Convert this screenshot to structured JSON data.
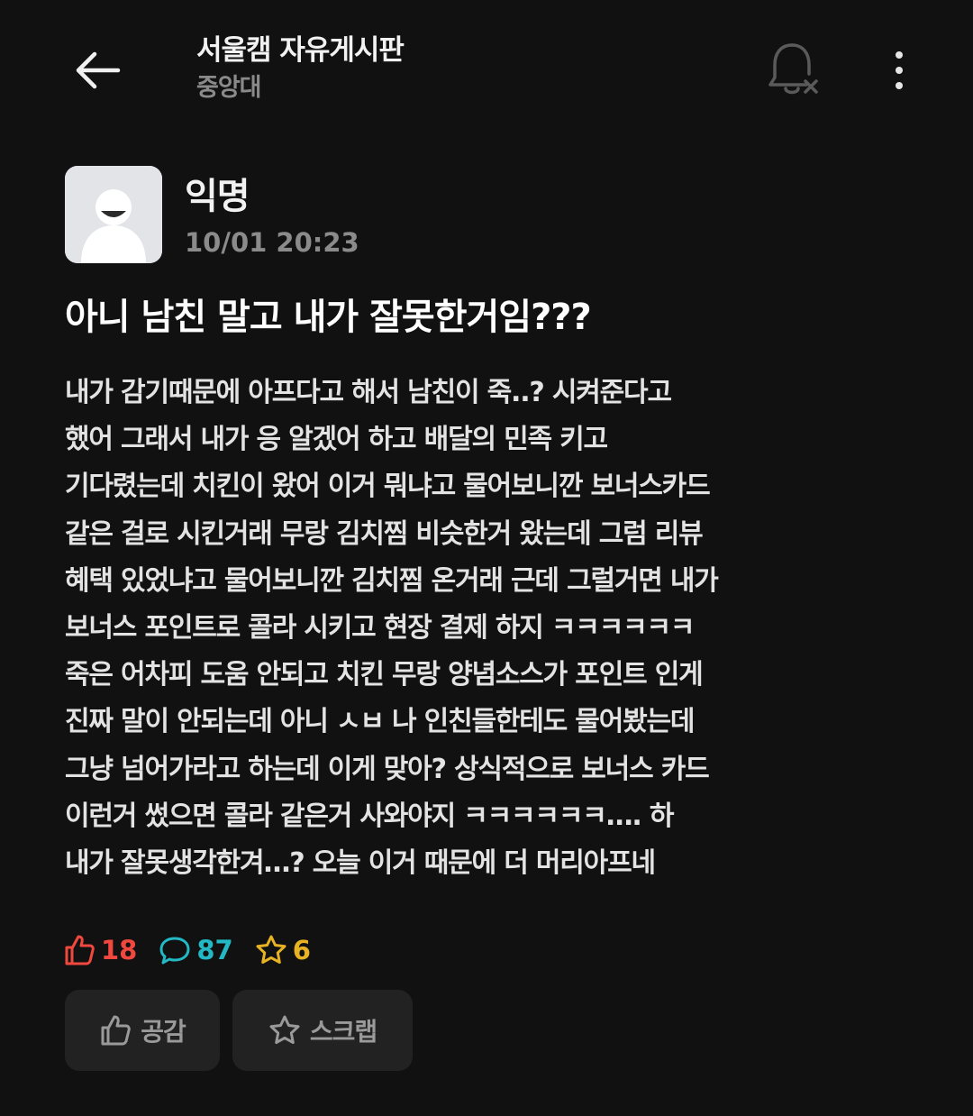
{
  "header": {
    "board_title": "서울캠 자유게시판",
    "board_subtitle": "중앙대",
    "back_icon": "arrow-left-icon",
    "notification_icon": "bell-off-icon",
    "more_icon": "more-vertical-icon"
  },
  "author": {
    "name": "익명",
    "timestamp": "10/01 20:23",
    "avatar_icon": "anonymous-avatar-icon"
  },
  "post": {
    "title": "아니 남친 말고 내가 잘못한거임???",
    "body_lines": [
      "내가 감기때문에 아프다고 해서 남친이 죽..? 시켜준다고",
      "했어 그래서 내가 응 알겠어 하고 배달의 민족 키고",
      "기다렸는데 치킨이 왔어 이거 뭐냐고 물어보니깐 보너스카드",
      "같은 걸로 시킨거래 무랑 김치찜 비슷한거 왔는데 그럼 리뷰",
      "혜택 있었냐고 물어보니깐 김치찜 온거래 근데 그럴거면 내가",
      "보너스 포인트로 콜라 시키고 현장 결제 하지 ㅋㅋㅋㅋㅋㅋ",
      "죽은 어차피 도움 안되고 치킨 무랑 양념소스가 포인트 인게",
      "진짜 말이 안되는데 아니 ㅅㅂ 나 인친들한테도 물어봤는데",
      "그냥 넘어가라고 하는데 이게 맞아? 상식적으로 보너스 카드",
      "이런거 썼으면 콜라 같은거 사와야지 ㅋㅋㅋㅋㅋㅋ…. 하",
      "내가 잘못생각한겨…?  오늘 이거 때문에 더 머리아프네"
    ]
  },
  "stats": {
    "likes": "18",
    "comments": "87",
    "scraps": "6",
    "like_color": "#f0483e",
    "comment_color": "#22b8c4",
    "scrap_color": "#e8b323"
  },
  "actions": {
    "like_label": "공감",
    "scrap_label": "스크랩"
  }
}
